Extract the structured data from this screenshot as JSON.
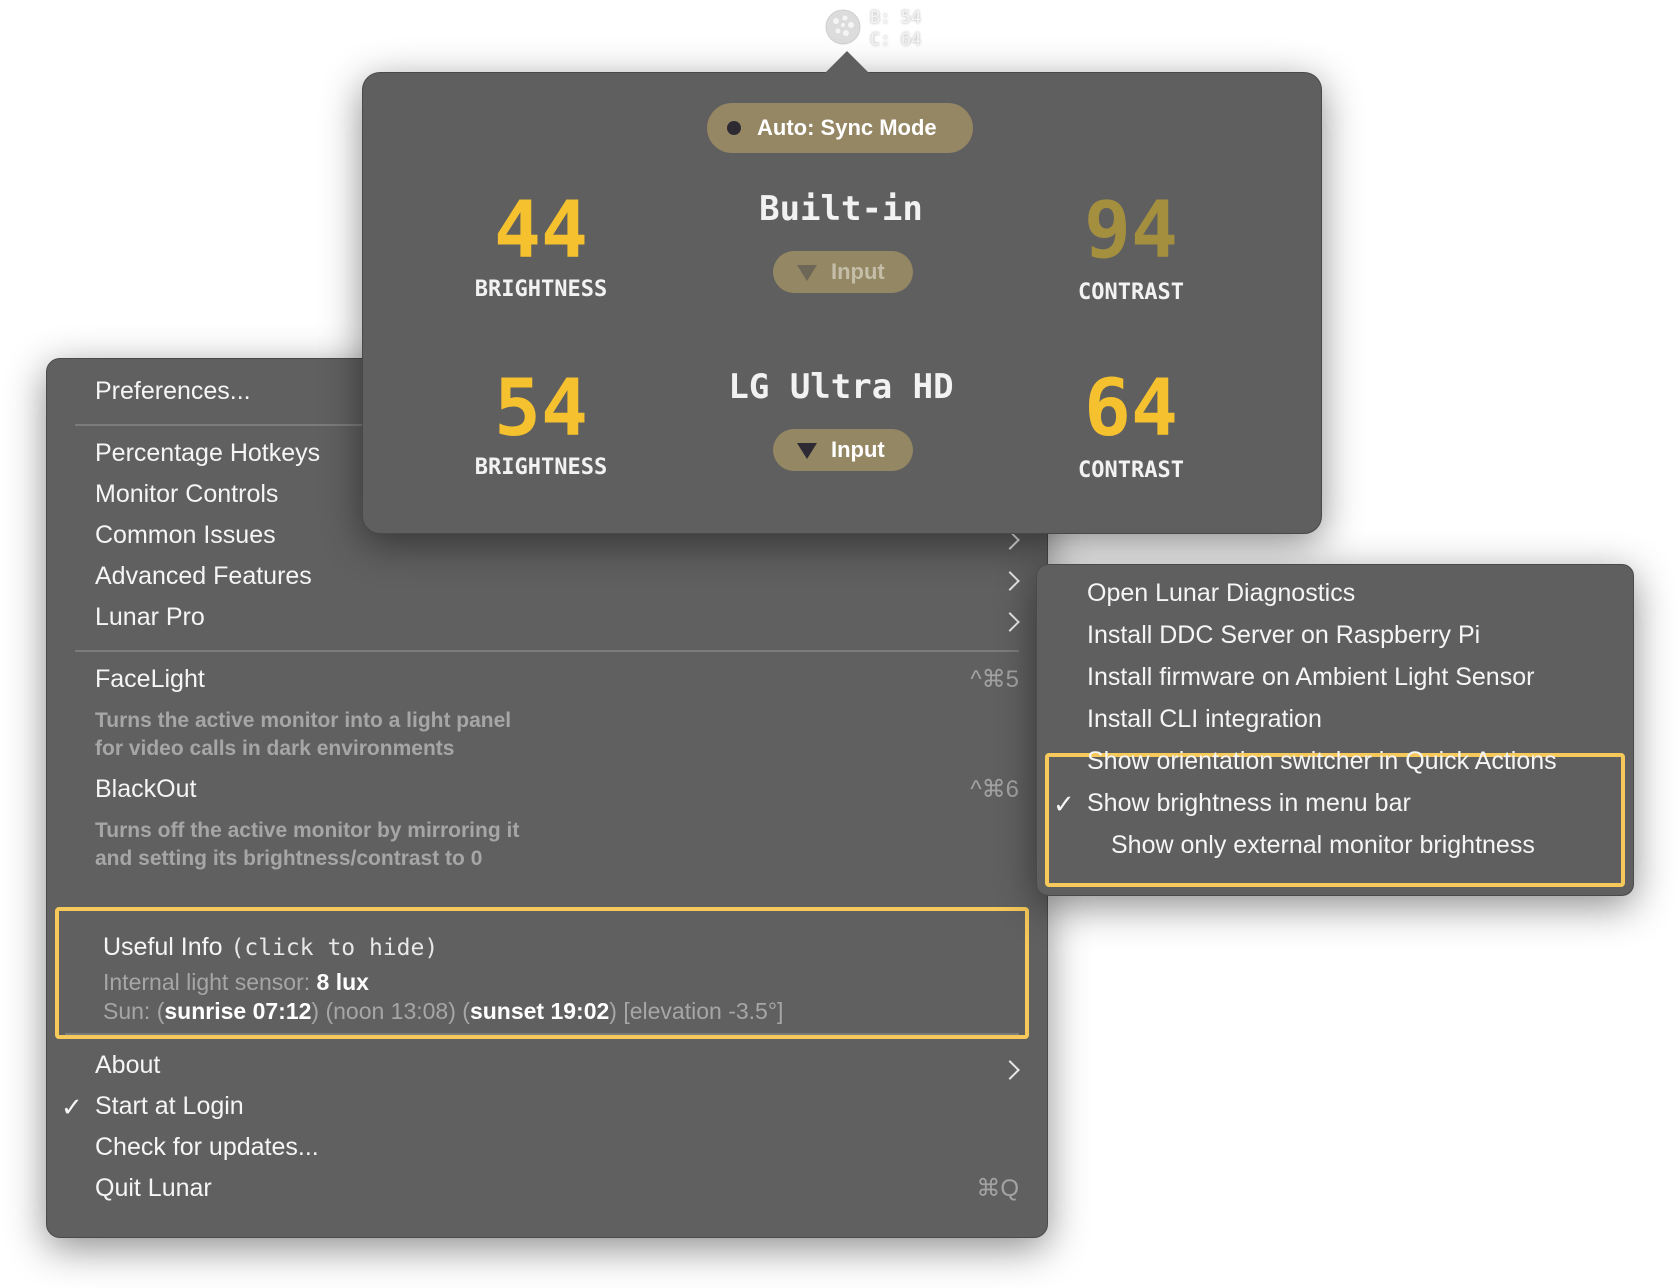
{
  "statusbar": {
    "b_text": "B: 54",
    "c_text": "C: 64",
    "icon": "lunar-icon"
  },
  "popover": {
    "sync_mode": "Auto: Sync Mode",
    "monitors": [
      {
        "name": "Built-in",
        "brightness": "44",
        "contrast": "94",
        "brightness_label": "BRIGHTNESS",
        "contrast_label": "CONTRAST",
        "input_label": "Input",
        "brightness_color": "#f5c12e",
        "contrast_color": "#a48f3f"
      },
      {
        "name": "LG Ultra HD",
        "brightness": "54",
        "contrast": "64",
        "brightness_label": "BRIGHTNESS",
        "contrast_label": "CONTRAST",
        "input_label": "Input",
        "brightness_color": "#f5c12e",
        "contrast_color": "#f5c12e"
      }
    ]
  },
  "menu": {
    "preferences": "Preferences...",
    "percentage_hotkeys": "Percentage Hotkeys",
    "monitor_controls": "Monitor Controls",
    "common_issues": "Common Issues",
    "advanced_features": "Advanced Features",
    "lunar_pro": "Lunar Pro",
    "facelight": {
      "label": "FaceLight",
      "shortcut": "^⌘5",
      "desc_1": "Turns the active monitor into a light panel",
      "desc_2": "for video calls in dark environments"
    },
    "blackout": {
      "label": "BlackOut",
      "shortcut": "^⌘6",
      "desc_1": "Turns off the active monitor by mirroring it",
      "desc_2": "and setting its brightness/contrast to 0"
    },
    "useful_info": {
      "title": "Useful Info",
      "hint": "(click to hide)",
      "sensor_label": "Internal light sensor: ",
      "sensor_value": "8 lux",
      "sun_label": "Sun: (",
      "sunrise": "sunrise 07:12",
      "noon": ") (noon 13:08) (",
      "sunset": "sunset 19:02",
      "elevation": ") [elevation -3.5°]"
    },
    "about": "About",
    "start_at_login": "Start at Login",
    "check_updates": "Check for updates...",
    "quit": "Quit Lunar",
    "quit_shortcut": "⌘Q",
    "checkmark": "✓"
  },
  "submenu": {
    "items": [
      "Open Lunar Diagnostics",
      "Install DDC Server on Raspberry Pi",
      "Install firmware on Ambient Light Sensor",
      "Install CLI integration",
      "Show orientation switcher in Quick Actions",
      "Show brightness in menu bar",
      "Show only external monitor brightness"
    ],
    "checkmark": "✓"
  },
  "colors": {
    "highlight": "#f6c95a",
    "accent": "#f5c12e",
    "pill": "#958763"
  }
}
